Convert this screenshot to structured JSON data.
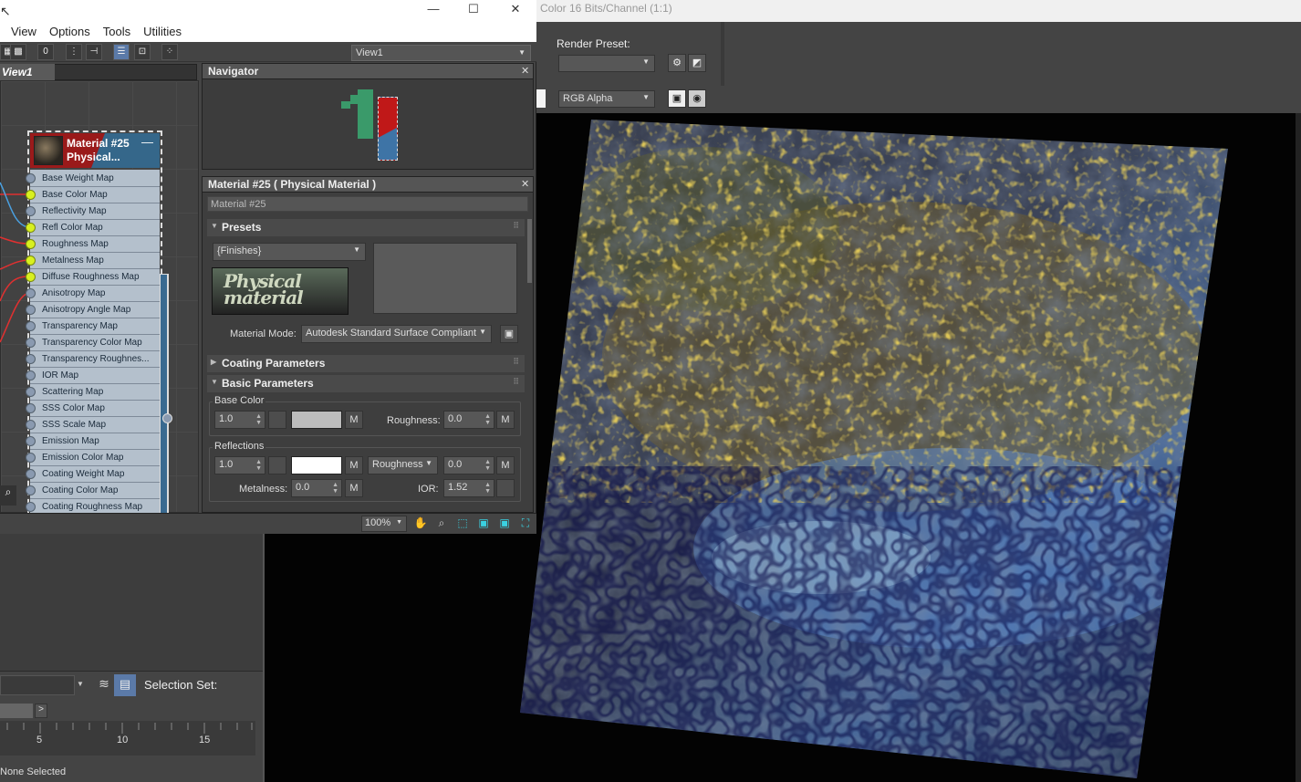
{
  "menu": [
    "View",
    "Options",
    "Tools",
    "Utilities"
  ],
  "view_select": "View1",
  "view_tab": "View1",
  "node": {
    "title_line1": "Material #25",
    "title_line2": "Physical...",
    "slots": [
      {
        "label": "Base Weight Map",
        "connected": false
      },
      {
        "label": "Base Color Map",
        "connected": true
      },
      {
        "label": "Reflectivity Map",
        "connected": false
      },
      {
        "label": "Refl Color Map",
        "connected": true
      },
      {
        "label": "Roughness Map",
        "connected": true
      },
      {
        "label": "Metalness Map",
        "connected": true
      },
      {
        "label": "Diffuse Roughness Map",
        "connected": true
      },
      {
        "label": "Anisotropy Map",
        "connected": false
      },
      {
        "label": "Anisotropy Angle Map",
        "connected": false
      },
      {
        "label": "Transparency Map",
        "connected": false
      },
      {
        "label": "Transparency Color Map",
        "connected": false
      },
      {
        "label": "Transparency Roughnes...",
        "connected": false
      },
      {
        "label": "IOR Map",
        "connected": false
      },
      {
        "label": "Scattering Map",
        "connected": false
      },
      {
        "label": "SSS Color Map",
        "connected": false
      },
      {
        "label": "SSS Scale Map",
        "connected": false
      },
      {
        "label": "Emission Map",
        "connected": false
      },
      {
        "label": "Emission Color Map",
        "connected": false
      },
      {
        "label": "Coating Weight Map",
        "connected": false
      },
      {
        "label": "Coating Color Map",
        "connected": false
      },
      {
        "label": "Coating Roughness Map",
        "connected": false
      }
    ]
  },
  "navigator": {
    "title": "Navigator"
  },
  "params": {
    "title": "Material #25  ( Physical Material )",
    "name": "Material #25",
    "presets": "Presets",
    "finishes": "{Finishes}",
    "logo": "Physical material",
    "material_mode_label": "Material Mode:",
    "material_mode": "Autodesk Standard Surface Compliant",
    "coating": "Coating Parameters",
    "basic": "Basic Parameters",
    "base_color_label": "Base Color",
    "base_weight": "1.0",
    "roughness_label": "Roughness:",
    "base_roughness": "0.0",
    "reflections_label": "Reflections",
    "refl_weight": "1.0",
    "refl_mode": "Roughness",
    "refl_roughness": "0.0",
    "metalness_label": "Metalness:",
    "metalness": "0.0",
    "ior_label": "IOR:",
    "ior": "1.52",
    "m": "M",
    "base_color_hex": "#bcbcbc",
    "refl_color_hex": "#ffffff"
  },
  "zoom": "100%",
  "render_frame": {
    "title": "Color 16 Bits/Channel (1:1)",
    "render_preset_label": "Render Preset:",
    "channel": "RGB Alpha"
  },
  "selection_set_label": "Selection Set:",
  "timeline_ticks": [
    "5",
    "10",
    "15"
  ],
  "status": "None Selected",
  "colors": {
    "accent": "#5b7aa8",
    "socket_on": "#d8f020",
    "node_header": "#9a1a1a"
  }
}
